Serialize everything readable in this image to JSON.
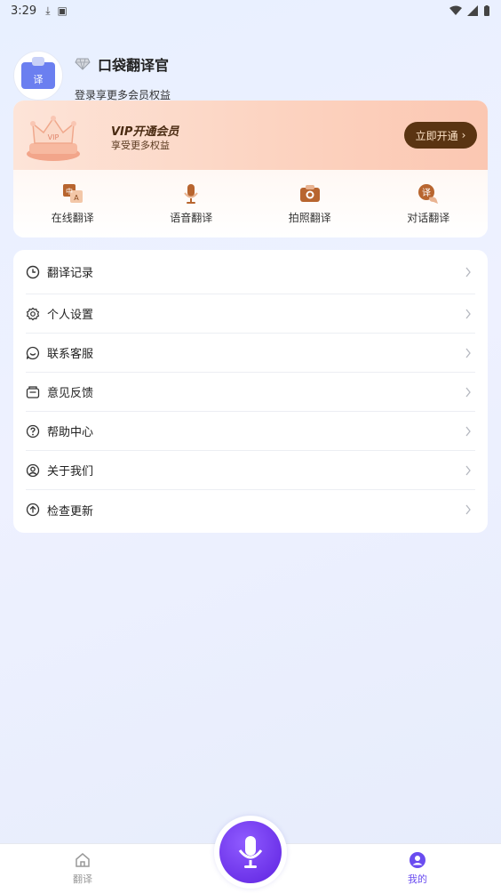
{
  "status_bar": {
    "time": "3:29"
  },
  "profile": {
    "nickname": "口袋翻译官",
    "login_hint": "登录享更多会员权益",
    "avatar_text": "译"
  },
  "vip": {
    "title": "VIP开通会员",
    "subtitle": "享受更多权益",
    "button_label": "立即开通",
    "colors": {
      "banner": "#fcd2bf",
      "button": "#5a3412"
    }
  },
  "tools": [
    {
      "label": "在线翻译",
      "icon": "text-translate-icon"
    },
    {
      "label": "语音翻译",
      "icon": "microphone-icon"
    },
    {
      "label": "拍照翻译",
      "icon": "camera-icon"
    },
    {
      "label": "对话翻译",
      "icon": "chat-translate-icon"
    }
  ],
  "menu": [
    {
      "label": "翻译记录",
      "icon": "clock-icon"
    },
    {
      "label": "个人设置",
      "icon": "gear-icon"
    },
    {
      "label": "联系客服",
      "icon": "chat-bubble-icon"
    },
    {
      "label": "意见反馈",
      "icon": "feedback-icon"
    },
    {
      "label": "帮助中心",
      "icon": "help-icon"
    },
    {
      "label": "关于我们",
      "icon": "user-circle-icon"
    },
    {
      "label": "检查更新",
      "icon": "arrow-up-circle-icon"
    }
  ],
  "bottom_nav": {
    "translate_label": "翻译",
    "mine_label": "我的",
    "active_color": "#6a4cf0"
  }
}
